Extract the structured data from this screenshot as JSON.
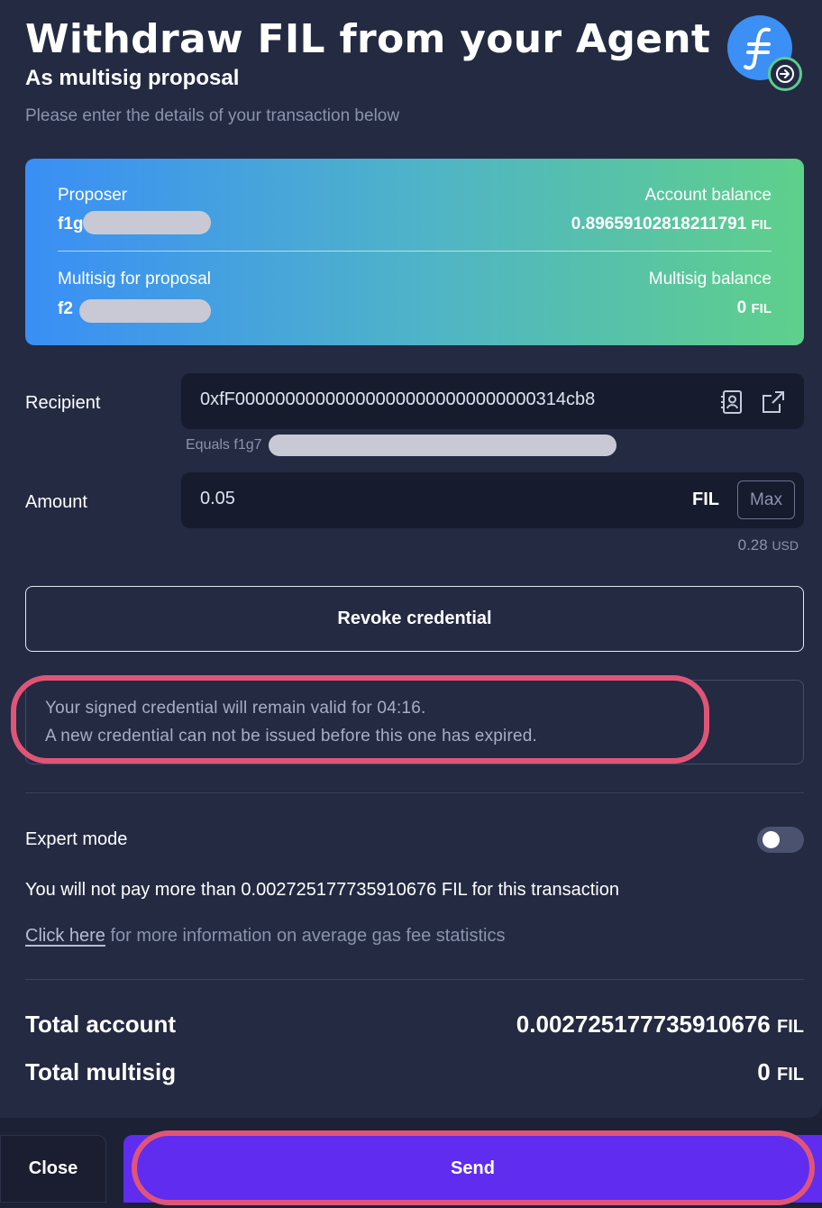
{
  "header": {
    "title": "Withdraw FIL from your Agent",
    "subtitle": "As multisig proposal",
    "description": "Please enter the details of your transaction below",
    "logo_icon": "filecoin-logo-icon",
    "badge_icon": "arrow-right-circle-icon"
  },
  "summary": {
    "proposer_label": "Proposer",
    "proposer_prefix": "f1g",
    "account_balance_label": "Account balance",
    "account_balance_value": "0.89659102818211791",
    "account_balance_unit": "FIL",
    "multisig_label": "Multisig for proposal",
    "multisig_prefix": "f2",
    "multisig_balance_label": "Multisig balance",
    "multisig_balance_value": "0",
    "multisig_balance_unit": "FIL"
  },
  "recipient": {
    "label": "Recipient",
    "value": "0xfF000000000000000000000000000000314cb8",
    "equals_prefix": "Equals f1g7",
    "address_book_icon": "address-book-icon",
    "external_link_icon": "external-link-icon"
  },
  "amount": {
    "label": "Amount",
    "value": "0.05",
    "unit": "FIL",
    "max_label": "Max",
    "usd_value": "0.28",
    "usd_unit": "USD"
  },
  "revoke_label": "Revoke credential",
  "notice": {
    "line1": "Your signed credential will remain valid for 04:16.",
    "line2": "A new credential can not be issued before this one has expired."
  },
  "expert_mode": {
    "label": "Expert mode",
    "enabled": false
  },
  "gas_text": "You will not pay more than 0.002725177735910676 FIL for this transaction",
  "gas_link": {
    "link_text": "Click here",
    "rest_text": " for more information on average gas fee statistics"
  },
  "totals": {
    "account_label": "Total account",
    "account_value": "0.002725177735910676",
    "account_unit": "FIL",
    "multisig_label": "Total multisig",
    "multisig_value": "0",
    "multisig_unit": "FIL"
  },
  "footer": {
    "close_label": "Close",
    "send_label": "Send"
  },
  "colors": {
    "background": "#232a42",
    "send": "#5f2cf0",
    "highlight": "#e05577",
    "gradient_start": "#3a8ef6",
    "gradient_end": "#5fd08a"
  }
}
